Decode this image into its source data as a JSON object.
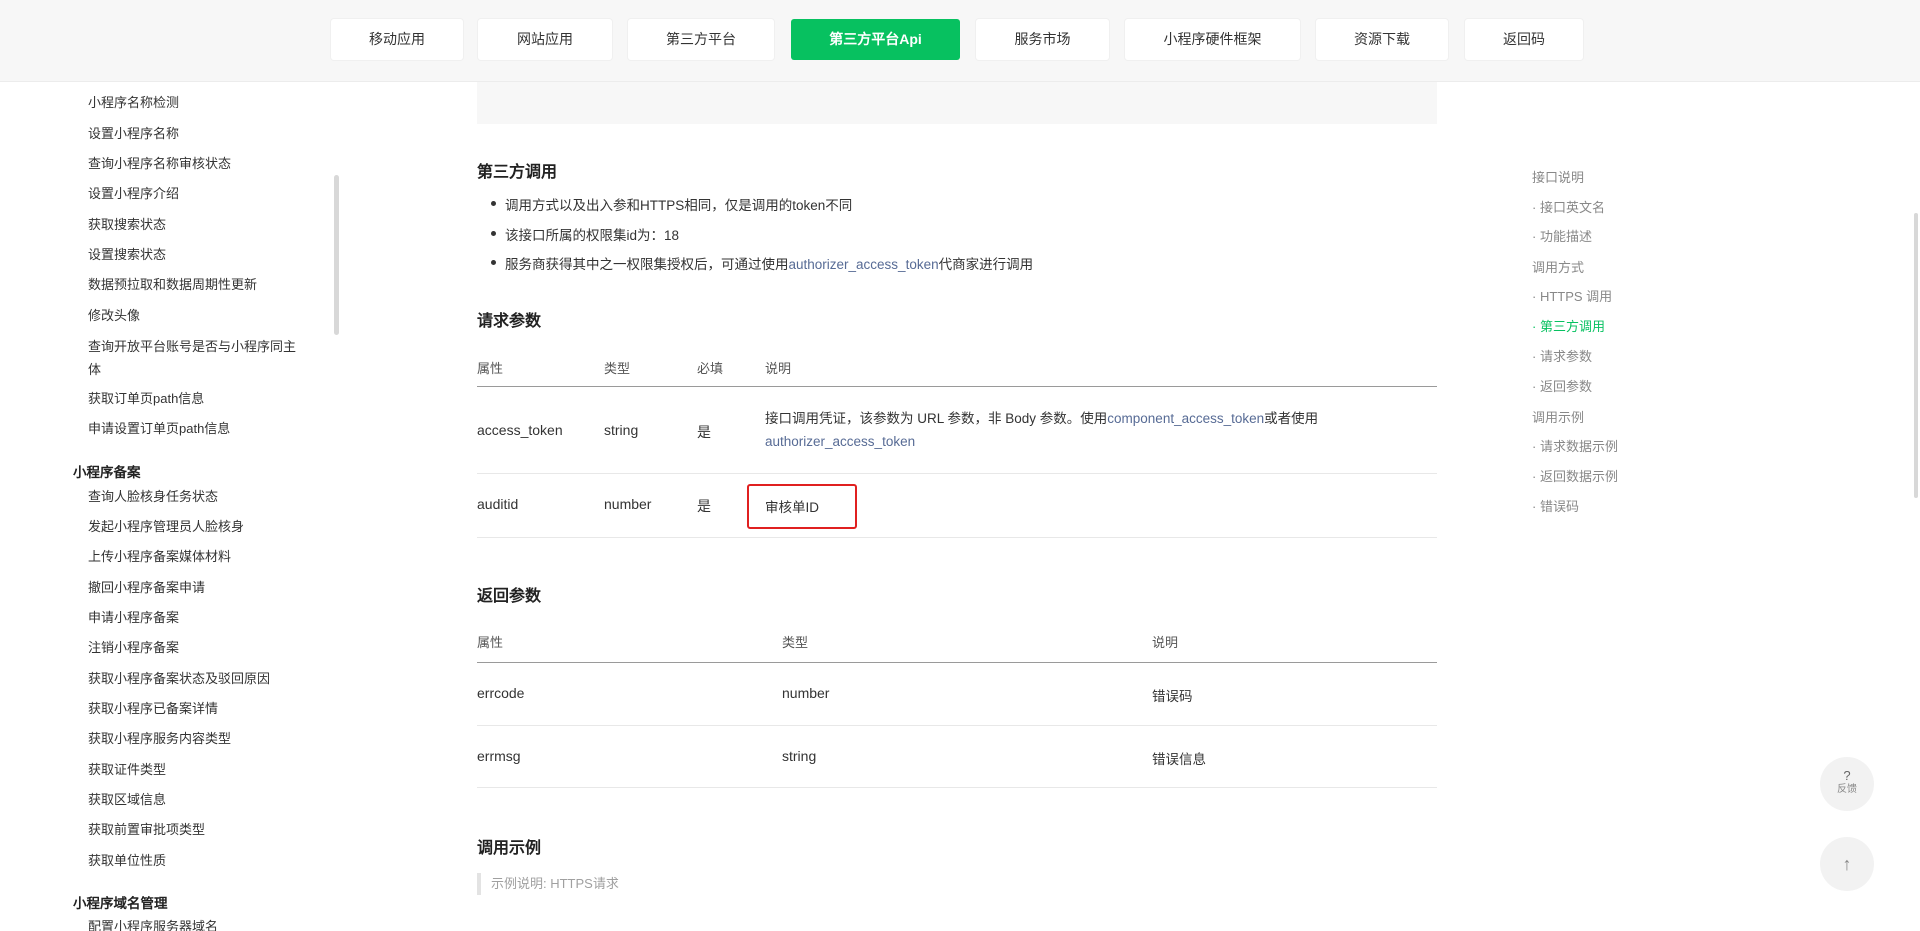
{
  "nav": {
    "tabs": [
      {
        "label": "移动应用",
        "active": false
      },
      {
        "label": "网站应用",
        "active": false
      },
      {
        "label": "第三方平台",
        "active": false
      },
      {
        "label": "第三方平台Api",
        "active": true
      },
      {
        "label": "服务市场",
        "active": false
      },
      {
        "label": "小程序硬件框架",
        "active": false
      },
      {
        "label": "资源下载",
        "active": false
      },
      {
        "label": "返回码",
        "active": false
      }
    ]
  },
  "sidebar": {
    "items_top": [
      "小程序名称检测",
      "设置小程序名称",
      "查询小程序名称审核状态",
      "设置小程序介绍",
      "获取搜索状态",
      "设置搜索状态",
      "数据预拉取和数据周期性更新",
      "修改头像",
      "查询开放平台账号是否与小程序同主体",
      "获取订单页path信息",
      "申请设置订单页path信息"
    ],
    "group_beian": "小程序备案",
    "items_beian": [
      "查询人脸核身任务状态",
      "发起小程序管理员人脸核身",
      "上传小程序备案媒体材料",
      "撤回小程序备案申请",
      "申请小程序备案",
      "注销小程序备案",
      "获取小程序备案状态及驳回原因",
      "获取小程序已备案详情",
      "获取小程序服务内容类型",
      "获取证件类型",
      "获取区域信息",
      "获取前置审批项类型",
      "获取单位性质"
    ],
    "group_domain": "小程序域名管理",
    "items_domain": [
      "配置小程序服务器域名"
    ]
  },
  "content": {
    "third_party": {
      "title": "第三方调用",
      "bullet1": "调用方式以及出入参和HTTPS相同，仅是调用的token不同",
      "bullet2": "该接口所属的权限集id为：18",
      "bullet3_pre": "服务商获得其中之一权限集授权后，可通过使用",
      "bullet3_link": "authorizer_access_token",
      "bullet3_post": "代商家进行调用"
    },
    "request_params": {
      "title": "请求参数",
      "headers": [
        "属性",
        "类型",
        "必填",
        "说明"
      ],
      "rows": [
        {
          "name": "access_token",
          "type": "string",
          "required": "是",
          "desc_pre": "接口调用凭证，该参数为 URL 参数，非 Body 参数。使用",
          "desc_link1": "component_access_token",
          "desc_mid": "或者使用",
          "desc_link2": "authorizer_access_token"
        },
        {
          "name": "auditid",
          "type": "number",
          "required": "是",
          "desc": "审核单ID"
        }
      ]
    },
    "return_params": {
      "title": "返回参数",
      "headers": [
        "属性",
        "类型",
        "说明"
      ],
      "rows": [
        {
          "name": "errcode",
          "type": "number",
          "desc": "错误码"
        },
        {
          "name": "errmsg",
          "type": "string",
          "desc": "错误信息"
        }
      ]
    },
    "example": {
      "title": "调用示例",
      "note": "示例说明: HTTPS请求"
    }
  },
  "toc": [
    {
      "label": "接口说明",
      "level": 1
    },
    {
      "label": "· 接口英文名",
      "level": 2
    },
    {
      "label": "· 功能描述",
      "level": 2
    },
    {
      "label": "调用方式",
      "level": 1
    },
    {
      "label": "· HTTPS 调用",
      "level": 2
    },
    {
      "label": "· 第三方调用",
      "level": 2,
      "active": true
    },
    {
      "label": "· 请求参数",
      "level": 2
    },
    {
      "label": "· 返回参数",
      "level": 2
    },
    {
      "label": "调用示例",
      "level": 1
    },
    {
      "label": "· 请求数据示例",
      "level": 2
    },
    {
      "label": "· 返回数据示例",
      "level": 2
    },
    {
      "label": "· 错误码",
      "level": 2
    }
  ],
  "float": {
    "feedback_q": "?",
    "feedback_label": "反馈",
    "top_arrow": "↑"
  },
  "colors": {
    "accent": "#07c160",
    "link": "#576b95",
    "highlight": "#e02020"
  }
}
